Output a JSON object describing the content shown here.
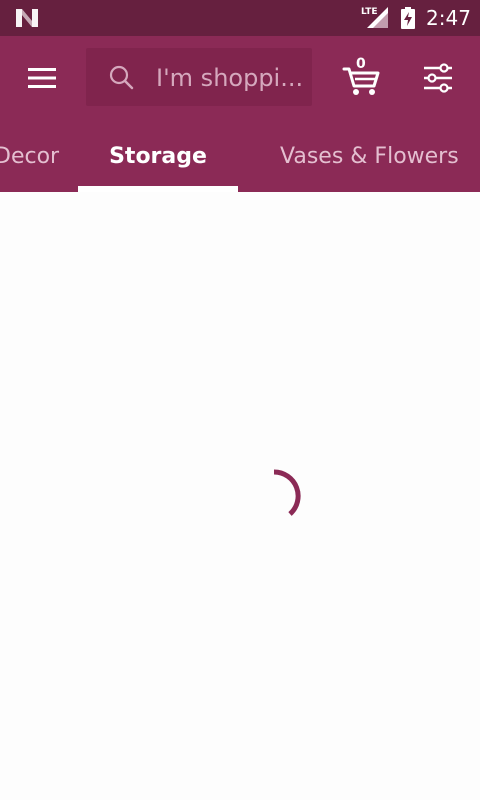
{
  "status_bar": {
    "time": "2:47",
    "network": "LTE",
    "icons": [
      "n-logo-icon",
      "lte-signal-icon",
      "battery-charging-icon"
    ]
  },
  "app_bar": {
    "search_placeholder": "I'm shoppi...",
    "cart_count": "0",
    "icons": [
      "menu-icon",
      "search-icon",
      "cart-icon",
      "filter-icon"
    ]
  },
  "tabs": {
    "items": [
      {
        "label": "Decor"
      },
      {
        "label": "Storage"
      },
      {
        "label": "Vases & Flowers"
      }
    ],
    "selected": "Storage"
  },
  "content": {
    "state": "loading"
  },
  "colors": {
    "status_bar": "#66203f",
    "app_bar": "#8b2a56",
    "search_box": "#80244d",
    "accent": "#8b2a56",
    "background": "#fdfdfd"
  }
}
